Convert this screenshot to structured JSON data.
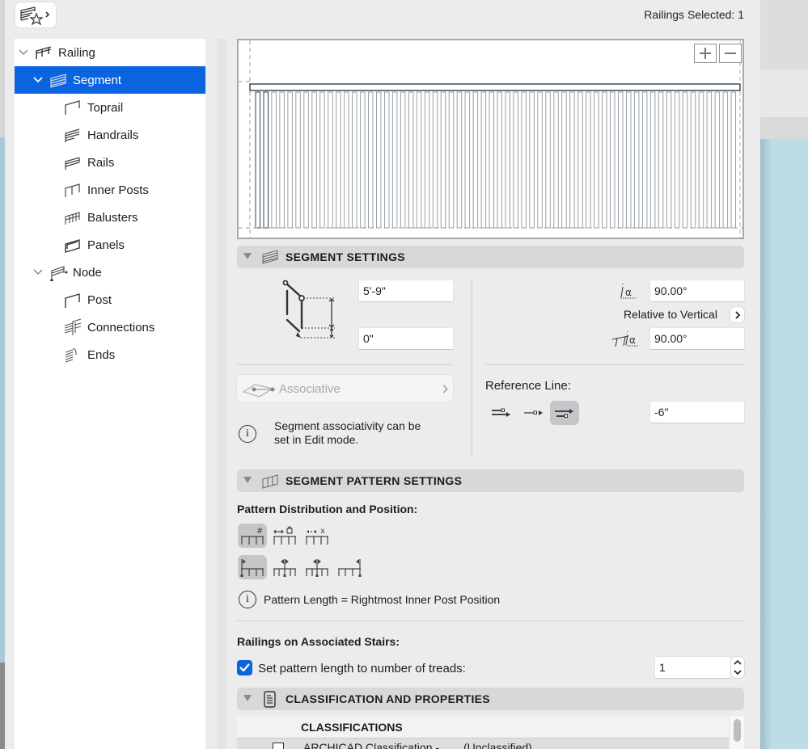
{
  "header": {
    "favorites_button": "favorites-star-icon",
    "selected_count": "Railings Selected: 1"
  },
  "tree": {
    "items": [
      {
        "label": "Railing",
        "level": 0,
        "expanded": true,
        "icon": "railing-icon"
      },
      {
        "label": "Segment",
        "level": 1,
        "expanded": true,
        "selected": true,
        "icon": "segment-icon"
      },
      {
        "label": "Toprail",
        "level": 2,
        "icon": "toprail-icon"
      },
      {
        "label": "Handrails",
        "level": 2,
        "icon": "handrails-icon"
      },
      {
        "label": "Rails",
        "level": 2,
        "icon": "rails-icon"
      },
      {
        "label": "Inner Posts",
        "level": 2,
        "icon": "inner-posts-icon"
      },
      {
        "label": "Balusters",
        "level": 2,
        "icon": "balusters-icon"
      },
      {
        "label": "Panels",
        "level": 2,
        "icon": "panels-icon"
      },
      {
        "label": "Node",
        "level": 1,
        "expanded": true,
        "icon": "node-icon"
      },
      {
        "label": "Post",
        "level": 2,
        "icon": "post-icon"
      },
      {
        "label": "Connections",
        "level": 2,
        "icon": "connections-icon"
      },
      {
        "label": "Ends",
        "level": 2,
        "icon": "ends-icon"
      }
    ]
  },
  "preview": {
    "zoom_in_label": "+",
    "zoom_out_label": "−",
    "baluster_count": 60
  },
  "segment_settings": {
    "title": "SEGMENT SETTINGS",
    "height_value": "5'-9\"",
    "offset_value": "0\"",
    "angle_top_value": "90.00°",
    "relative_label": "Relative to Vertical",
    "angle_bottom_value": "90.00°",
    "associative_label": "Associative",
    "info_text_line1": "Segment associativity can be",
    "info_text_line2": "set in Edit mode.",
    "reference_line_label": "Reference Line:",
    "reference_line_options": [
      "reference-left-icon",
      "reference-center-icon",
      "reference-right-icon"
    ],
    "reference_line_selected": 2,
    "reference_offset_value": "-6\""
  },
  "pattern_settings": {
    "title": "SEGMENT PATTERN SETTINGS",
    "distribution_label": "Pattern Distribution and Position:",
    "distribution_options_row1": [
      "fixed-number-icon",
      "fixed-length-icon",
      "custom-length-icon"
    ],
    "distribution_options_row2": [
      "align-start-icon",
      "align-center-icon",
      "align-middle-icon",
      "align-end-icon"
    ],
    "selected_row1": 0,
    "selected_row2": 0,
    "info_text": "Pattern Length = Rightmost Inner Post Position",
    "stairs_label": "Railings on Associated Stairs:",
    "checkbox_label": "Set pattern length to number of treads:",
    "checkbox_checked": true,
    "treads_value": "1"
  },
  "classification": {
    "title": "CLASSIFICATION AND PROPERTIES",
    "table_header": "CLASSIFICATIONS",
    "rows": [
      {
        "name": "ARCHICAD Classification -",
        "value": "(Unclassified)"
      }
    ]
  },
  "colors": {
    "accent": "#0a64e0",
    "panel_bg": "#ececec",
    "section_header_bg": "#d8d8d8"
  }
}
